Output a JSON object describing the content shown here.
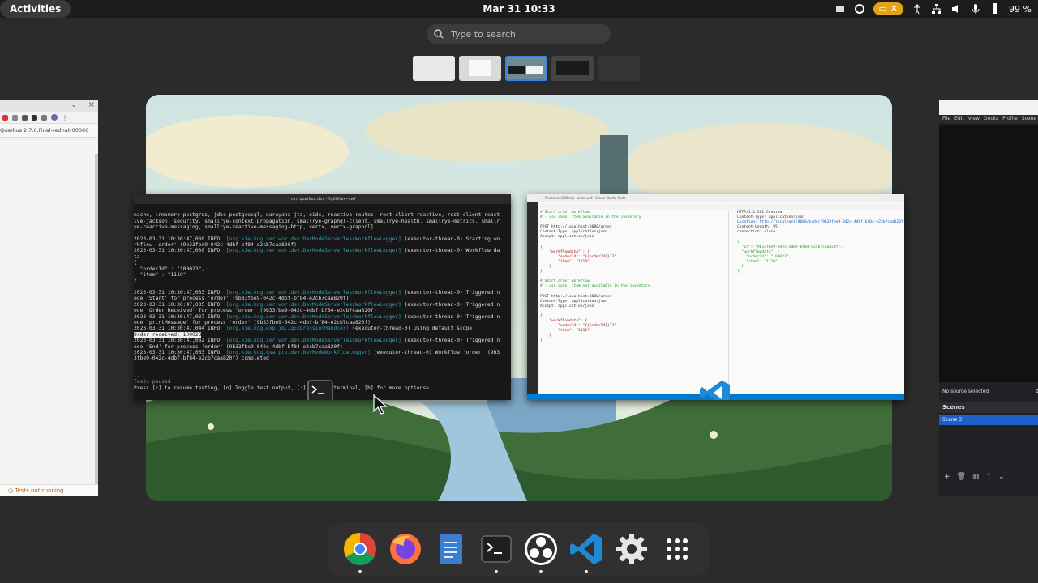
{
  "topbar": {
    "activities_label": "Activities",
    "clock": "Mar 31  10:33",
    "battery_percent": "99 %",
    "close_glyph": "✕"
  },
  "search": {
    "placeholder": "Type to search"
  },
  "left_window": {
    "tab_title": "Quarkus 2.7.6.Final-redhat-00006",
    "status_text": "Tests not running"
  },
  "right_window": {
    "menu": [
      "File",
      "Edit",
      "View",
      "Docks",
      "Profile",
      "Scene"
    ],
    "no_source": "No source selected",
    "scenes_header": "Scenes",
    "scene_item": "Scene 3"
  },
  "terminal": {
    "title": "mvn quarkus:dev -Dgitfilter=swf",
    "lines": [
      "nache, inmemory-postgres, jdbc-postgresql, narayana-jta, oidc, reactive-routes, rest-client-reactive, rest-client-react",
      "ive-jackson, security, smallrye-context-propagation, smallrye-graphql-client, smallrye-health, smallrye-metrics, smallr",
      "ye-reactive-messaging, smallrye-reactive-messaging-http, vertx, vertx-graphql]"
    ],
    "log_time_1": "2023-03-31 10:30:47,030 INFO",
    "log_logger": "[org.kie.kog.ser.wor.dev.DevModeServerlessWorkflowLogger]",
    "log_thread": "(executor-thread-0)",
    "log_msg_start": "Starting wo",
    "log_msg_2": "rkflow 'order' (9b33fbe9-042c-4dbf-bf84-e2cb7caa820f)",
    "log_msg_data": "Workflow da",
    "log_ta": "ta",
    "json_open": "{",
    "json_order": "  \"orderId\" : \"100023\",",
    "json_item": "  \"item\" : \"1110\"",
    "json_close": "}",
    "l_triggered_1": "2023-03-31 10:30:47,033 INFO",
    "l_triggered_1b": "ode 'Start' for process 'order' (9b33fbe9-042c-4dbf-bf84-e2cb7caa820f)",
    "l_triggered_2": "2023-03-31 10:30:47,035 INFO",
    "l_triggered_2b": "ode 'Order Received' for process 'order' (9b33fbe9-042c-4dbf-bf84-e2cb7caa820f)",
    "l_triggered_3": "2023-03-31 10:30:47,037 INFO",
    "l_triggered_3b": "ode 'printMessage' for process 'order' (9b33fbe9-042c-4dbf-bf84-e2cb7caa820f)",
    "l_jq": "2023-03-31 10:30:47,044 INFO",
    "jq_logger": "[org.kie.kog.exp.jq.JqExpressionHandler]",
    "jq_msg": "(executor-thread-0) Using default scope",
    "order_received": "Order received: 100023",
    "l_triggered_4": "2023-03-31 10:30:47,062 INFO",
    "l_triggered_4b": "ode 'End' for process 'order' (9b33fbe9-042c-4dbf-bf84-e2cb7caa820f)",
    "l_done": "2023-03-31 10:30:47,063 INFO",
    "done_logger": "[org.kie.kog.qua.pro.dev.DevModeWorkflowLogger]",
    "done_msg": "(executor-thread-0) Workflow 'order' (9b3",
    "done_msg_b": "3fbe9-042c-4dbf-bf84-e2cb7caa820f) completed",
    "triggered_n": "Triggered n",
    "tests_dash": "--",
    "tests_paused": "Tests paused",
    "prompt": "Press [r] to resume testing, [o] Toggle test output, [:] for the terminal, [h] for more options>"
  },
  "vscode": {
    "window_title": "Response(430ms) - order.wsf - Visual Studio Code",
    "req_comment_1": "# Start order workflow",
    "req_comment_2": "# - use case: item available in the inventory",
    "req_post": "POST http://localhost:8080/order",
    "req_ct": "Content-Type: application/json",
    "req_accept": "Accept: application/json",
    "req_body": "{\n    \"workflowdata\" : {\n        \"orderId\": \"{{orderId}}23\",\n        \"item\": \"1110\"\n    }\n}",
    "req2_comment_2": "# - use case: item not available in the inventory",
    "req2_body": "{\n    \"workflowdata\": {\n        \"orderId\": \"{{orderId}}23\",\n        \"item\": \"1111\"\n    }\n}",
    "resp_status": "HTTP/1.1 201 Created",
    "resp_ct": "Content-Type: application/json",
    "resp_location": "Location: http://localhost:8080/order/9b33fbe9-042c-4dbf-bf84-e2cb7caa820f",
    "resp_length": "Content-Length: 95",
    "resp_conn": "connection: close",
    "resp_body": "{\n  \"id\": \"9b33fbe9-042c-4dbf-bf84-e2cb7caa820f\",\n  \"workflowdata\": {\n    \"orderId\": \"100023\",\n    \"item\": \"1110\"\n  }\n}"
  },
  "dock": {
    "apps": [
      "chrome-icon",
      "firefox-icon",
      "text-editor-icon",
      "terminal-icon",
      "obs-icon",
      "vscode-icon",
      "settings-icon",
      "app-grid-icon"
    ]
  },
  "colors": {
    "accent": "#3584e4",
    "tray_pill": "#e3a21a",
    "vscode_blue": "#007acc"
  }
}
